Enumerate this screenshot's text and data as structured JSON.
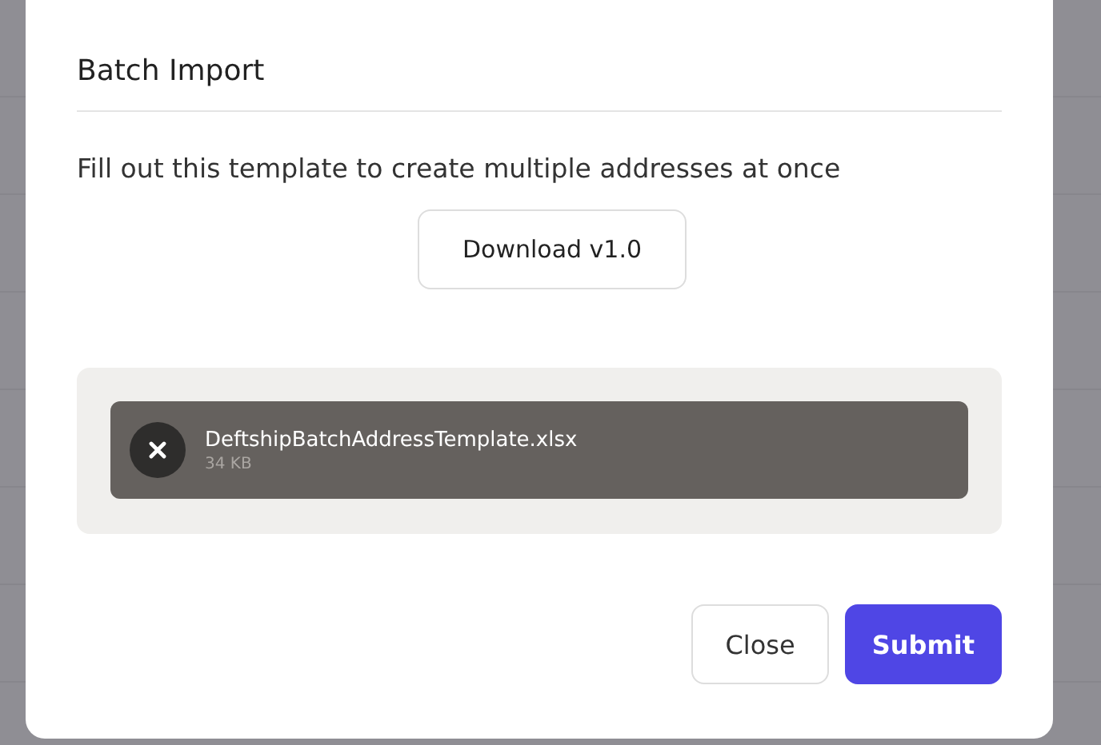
{
  "dialog": {
    "title": "Batch Import",
    "description": "Fill out this template to create multiple addresses at once",
    "download_button": "Download v1.0",
    "upload": {
      "file_name": "DeftshipBatchAddressTemplate.xlsx",
      "file_size": "34 KB"
    },
    "buttons": [
      {
        "label": "Close",
        "kind": "secondary"
      },
      {
        "label": "Submit",
        "kind": "primary"
      }
    ]
  }
}
